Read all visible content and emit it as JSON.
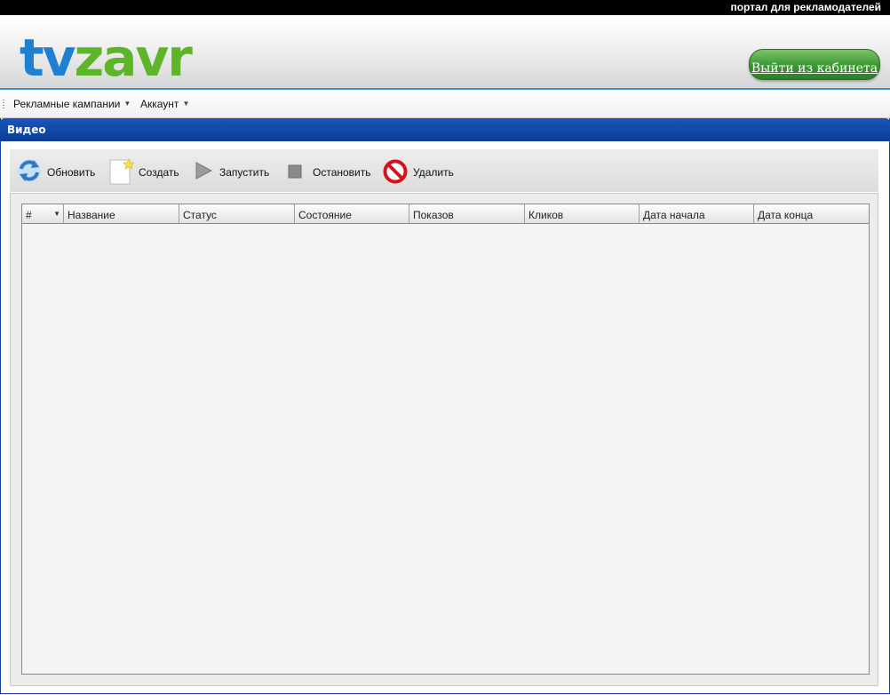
{
  "topbar": {
    "tagline": "портал для рекламодателей"
  },
  "header": {
    "logo": {
      "part1": "tv",
      "part2": "zavr"
    },
    "logout_label": "Выйти из кабинета"
  },
  "menu": {
    "items": [
      {
        "label": "Рекламные кампании",
        "arrow": "▼"
      },
      {
        "label": "Аккаунт",
        "arrow": "▼"
      }
    ]
  },
  "panel": {
    "title": "Видео"
  },
  "toolbar": {
    "refresh_label": "Обновить",
    "create_label": "Создать",
    "start_label": "Запустить",
    "stop_label": "Остановить",
    "delete_label": "Удалить"
  },
  "grid": {
    "columns": [
      "#",
      "Название",
      "Статус",
      "Состояние",
      "Показов",
      "Кликов",
      "Дата начала",
      "Дата конца"
    ],
    "sort_arrow": "▼",
    "rows": []
  },
  "colors": {
    "accent_blue": "#0c3c98",
    "logo_blue": "#1f7fd0",
    "logo_green": "#5fb52a",
    "logout_green": "#3e9a34"
  }
}
